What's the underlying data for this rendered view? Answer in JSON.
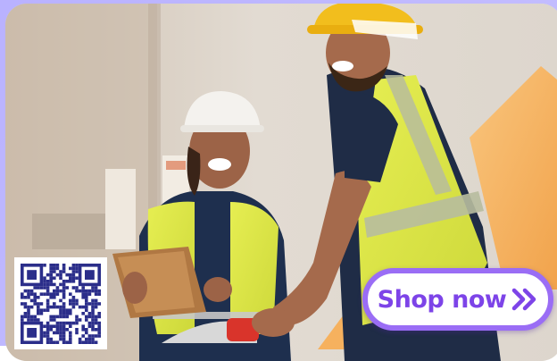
{
  "ad": {
    "cta_label": "Shop now",
    "cta_icon": "double-chevron-right-icon",
    "qr_icon": "qr-code-icon",
    "photo_subject": "warehouse-workers-photo"
  },
  "colors": {
    "frame": "#b9b2ff",
    "cta_text": "#7d44e8",
    "cta_border": "#9a6df5",
    "accent_orange": "#f6b15e"
  }
}
